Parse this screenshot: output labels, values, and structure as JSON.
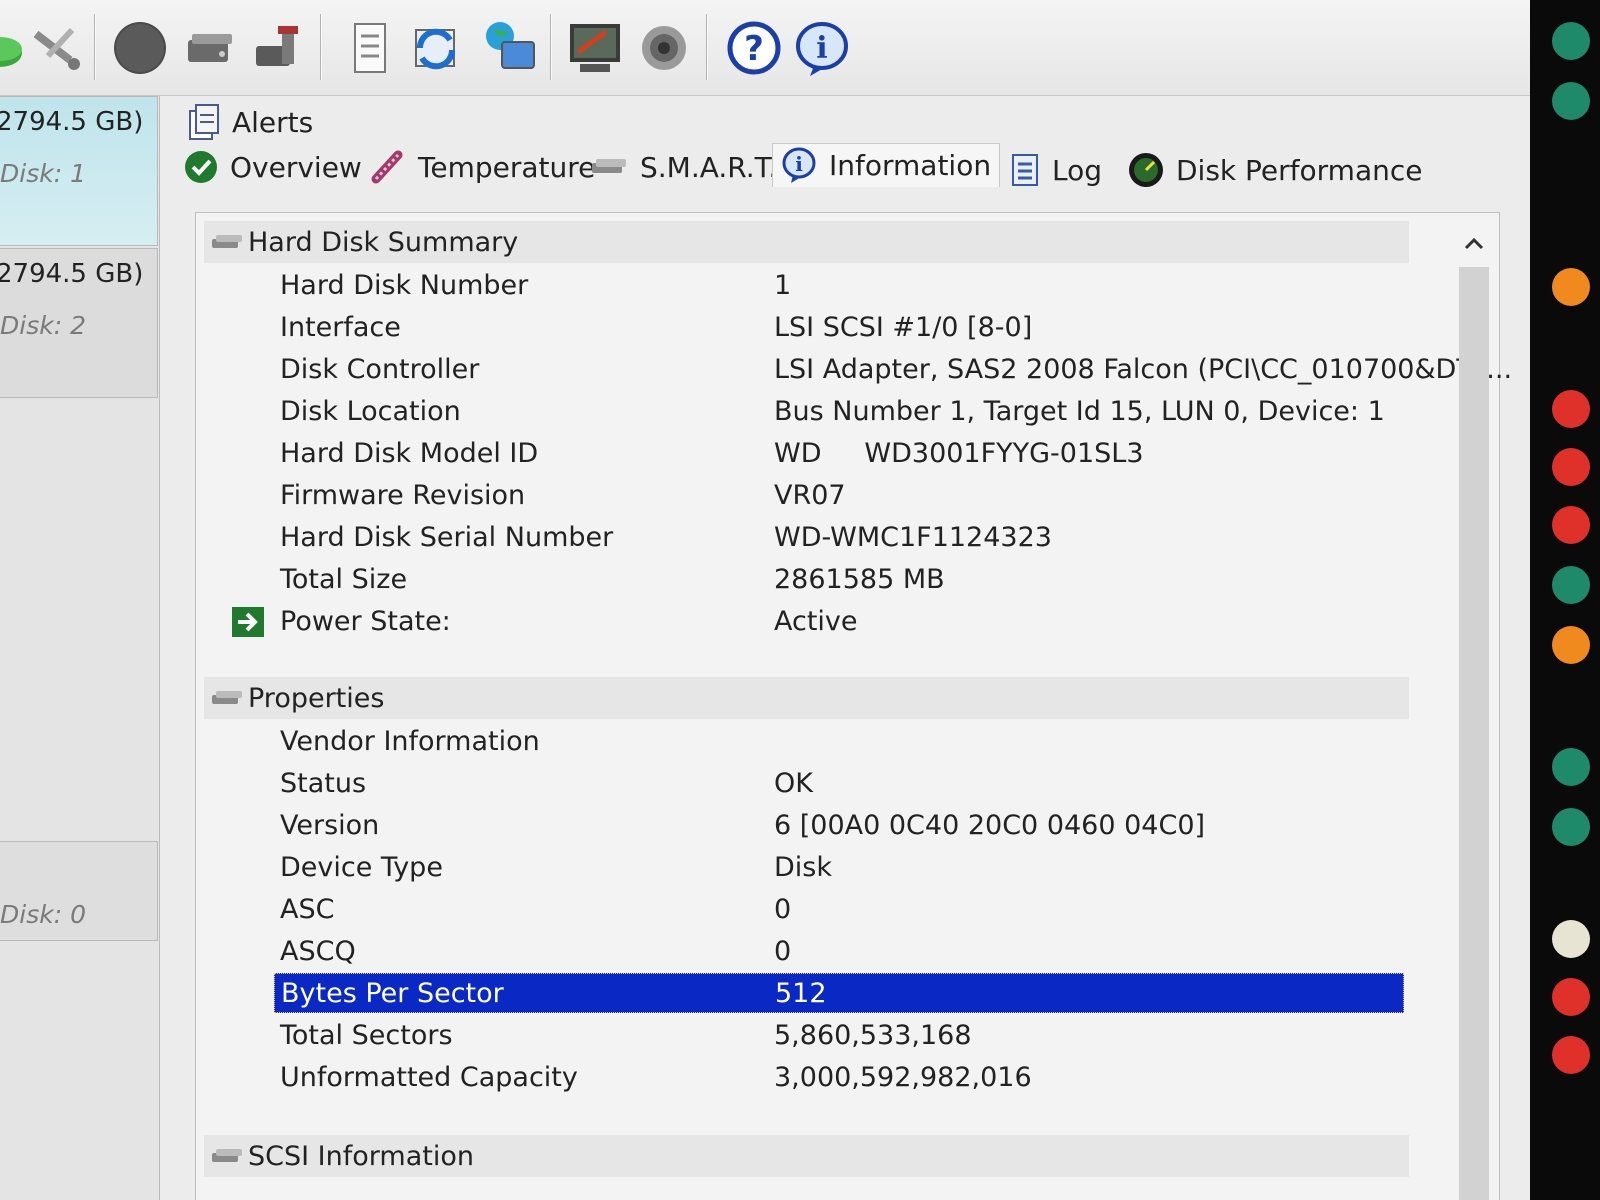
{
  "toolbar": {
    "buttons": [
      {
        "name": "green-disk-icon"
      },
      {
        "name": "tools-icon"
      },
      {
        "name": "gray-circle-icon"
      },
      {
        "name": "drive-icon"
      },
      {
        "name": "drive-tools-icon"
      },
      {
        "name": "document-icon"
      },
      {
        "name": "refresh-icon"
      },
      {
        "name": "network-globe-icon"
      },
      {
        "name": "monitor-report-icon"
      },
      {
        "name": "speaker-icon"
      },
      {
        "name": "help-icon"
      },
      {
        "name": "info-icon"
      }
    ]
  },
  "disks": [
    {
      "size": "2794.5 GB)",
      "label": "Disk: 1"
    },
    {
      "size": "2794.5 GB)",
      "label": "Disk: 2"
    },
    {
      "label": "Disk: 0"
    }
  ],
  "tabs": {
    "alerts": "Alerts",
    "overview": "Overview",
    "temperature": "Temperature",
    "smart": "S.M.A.R.T.",
    "information": "Information",
    "log": "Log",
    "disk_performance": "Disk Performance",
    "active": "Information"
  },
  "summary": {
    "title": "Hard Disk Summary",
    "rows": [
      {
        "key": "Hard Disk Number",
        "value": "1"
      },
      {
        "key": "Interface",
        "value": "LSI  SCSI #1/0 [8-0]"
      },
      {
        "key": "Disk Controller",
        "value": "LSI Adapter, SAS2 2008 Falcon (PCI\\CC_010700&DT_..."
      },
      {
        "key": "Disk Location",
        "value": "Bus Number 1, Target Id 15, LUN 0, Device: 1"
      },
      {
        "key": "Hard Disk Model ID",
        "value": "WD     WD3001FYYG-01SL3"
      },
      {
        "key": "Firmware Revision",
        "value": "VR07"
      },
      {
        "key": "Hard Disk Serial Number",
        "value": "WD-WMC1F1124323"
      },
      {
        "key": "Total Size",
        "value": "2861585 MB"
      },
      {
        "key": "Power State:",
        "value": "Active"
      }
    ]
  },
  "properties": {
    "title": "Properties",
    "rows": [
      {
        "key": "Vendor Information",
        "value": ""
      },
      {
        "key": "Status",
        "value": "OK"
      },
      {
        "key": "Version",
        "value": "6 [00A0 0C40 20C0 0460 04C0]"
      },
      {
        "key": "Device Type",
        "value": "Disk"
      },
      {
        "key": "ASC",
        "value": "0"
      },
      {
        "key": "ASCQ",
        "value": "0"
      },
      {
        "key": "Bytes Per Sector",
        "value": "512"
      },
      {
        "key": "Total Sectors",
        "value": "5,860,533,168"
      },
      {
        "key": "Unformatted Capacity",
        "value": "3,000,592,982,016"
      }
    ]
  },
  "scsi": {
    "title": "SCSI Information"
  },
  "colors": {
    "selection": "#0a28c4",
    "status_dots": [
      "#1e8a6a",
      "#1e8a6a",
      "#f08a1e",
      "#e0302a",
      "#e0302a",
      "#e0302a",
      "#1e8a6a",
      "#f08a1e",
      "#1e8a6a",
      "#1e8a6a",
      "#e8e4d4",
      "#e0302a",
      "#e0302a"
    ]
  }
}
